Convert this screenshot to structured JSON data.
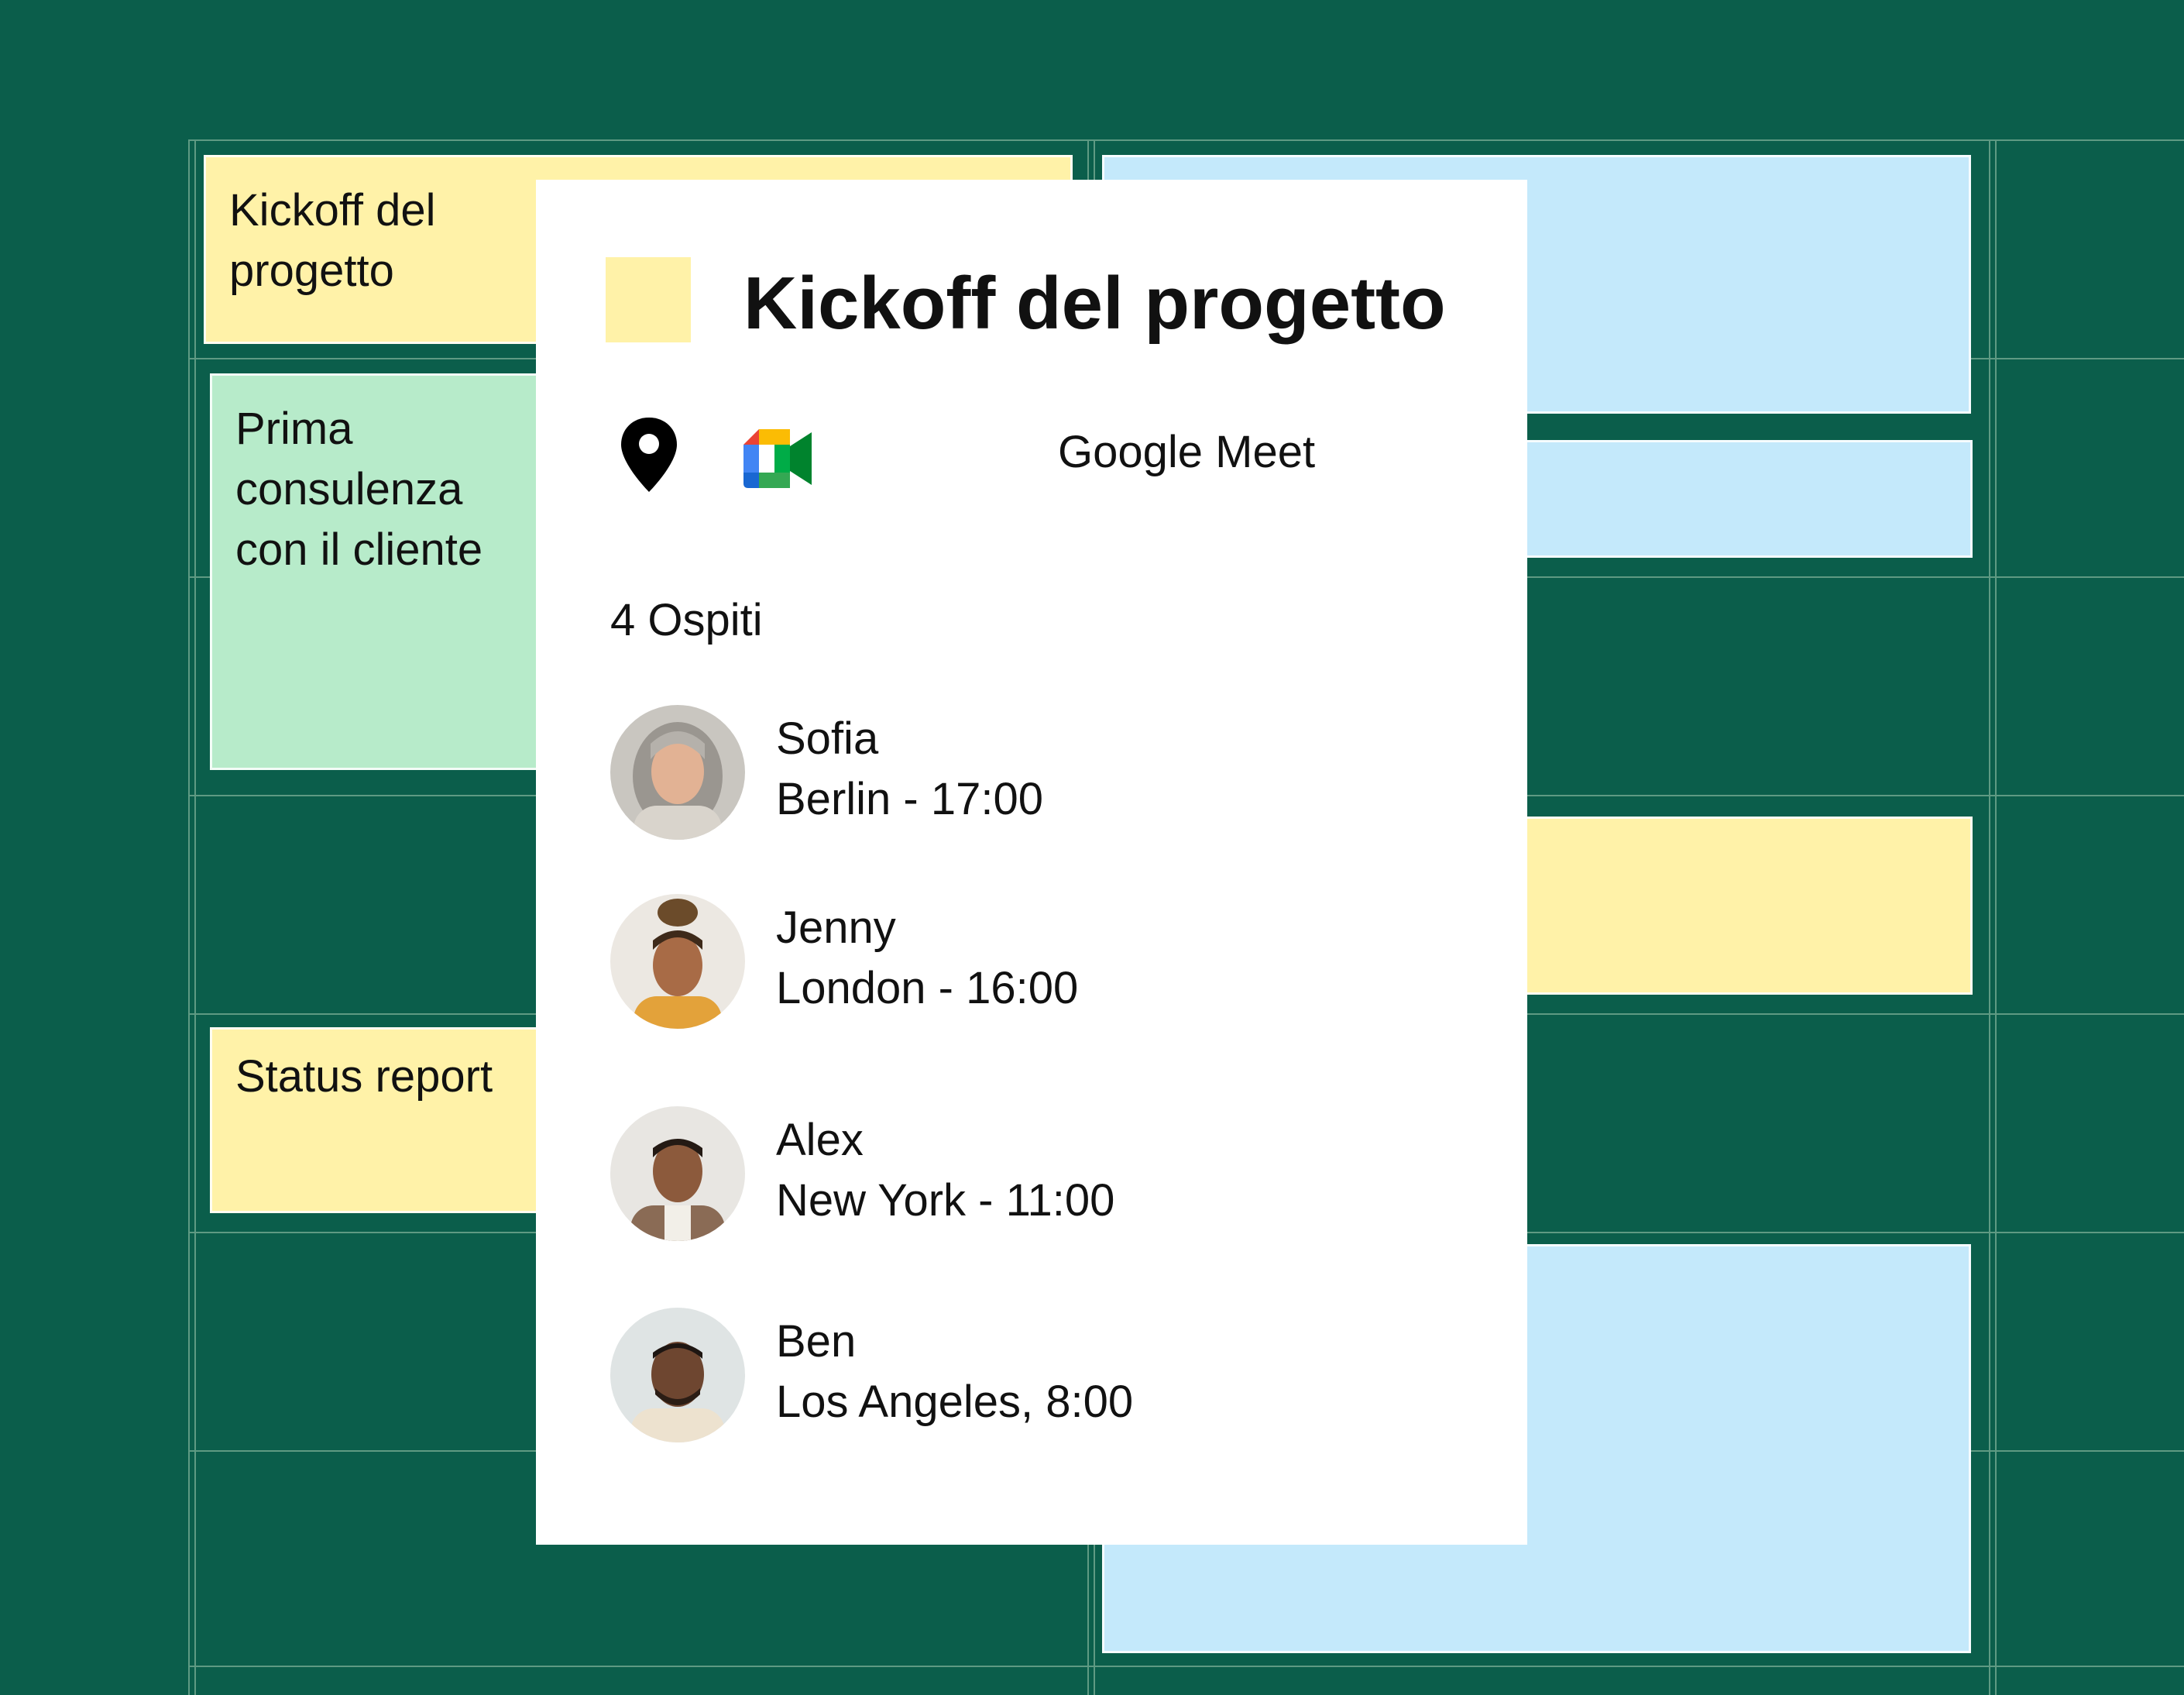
{
  "colors": {
    "background": "#0b5e4b",
    "gridline": "#5f9a83",
    "event_yellow": "#fff2a8",
    "event_green": "#b7ebca",
    "event_blue": "#c4e9fb",
    "popup": "#ffffff"
  },
  "calendar": {
    "events": [
      {
        "label": "Kickoff del\nprogetto",
        "color": "yellow"
      },
      {
        "label": "Prima\nconsulenza\ncon il cliente",
        "color": "green"
      },
      {
        "label": "Status report",
        "color": "yellow"
      },
      {
        "label": "",
        "color": "blue"
      },
      {
        "label": "",
        "color": "blue"
      },
      {
        "label": "",
        "color": "yellow"
      },
      {
        "label": "",
        "color": "blue"
      }
    ]
  },
  "popup": {
    "title": "Kickoff del progetto",
    "location_icon": "location-pin-icon",
    "conference_icon": "google-meet-icon",
    "conference_label": "Google Meet",
    "guests_count_label": "4 Ospiti",
    "guests": [
      {
        "name": "Sofia",
        "detail": "Berlin - 17:00",
        "avatar": "avatar-photo"
      },
      {
        "name": "Jenny",
        "detail": "London - 16:00",
        "avatar": "avatar-photo"
      },
      {
        "name": "Alex",
        "detail": "New York - 11:00",
        "avatar": "avatar-photo"
      },
      {
        "name": "Ben",
        "detail": "Los Angeles, 8:00",
        "avatar": "avatar-photo"
      }
    ]
  }
}
